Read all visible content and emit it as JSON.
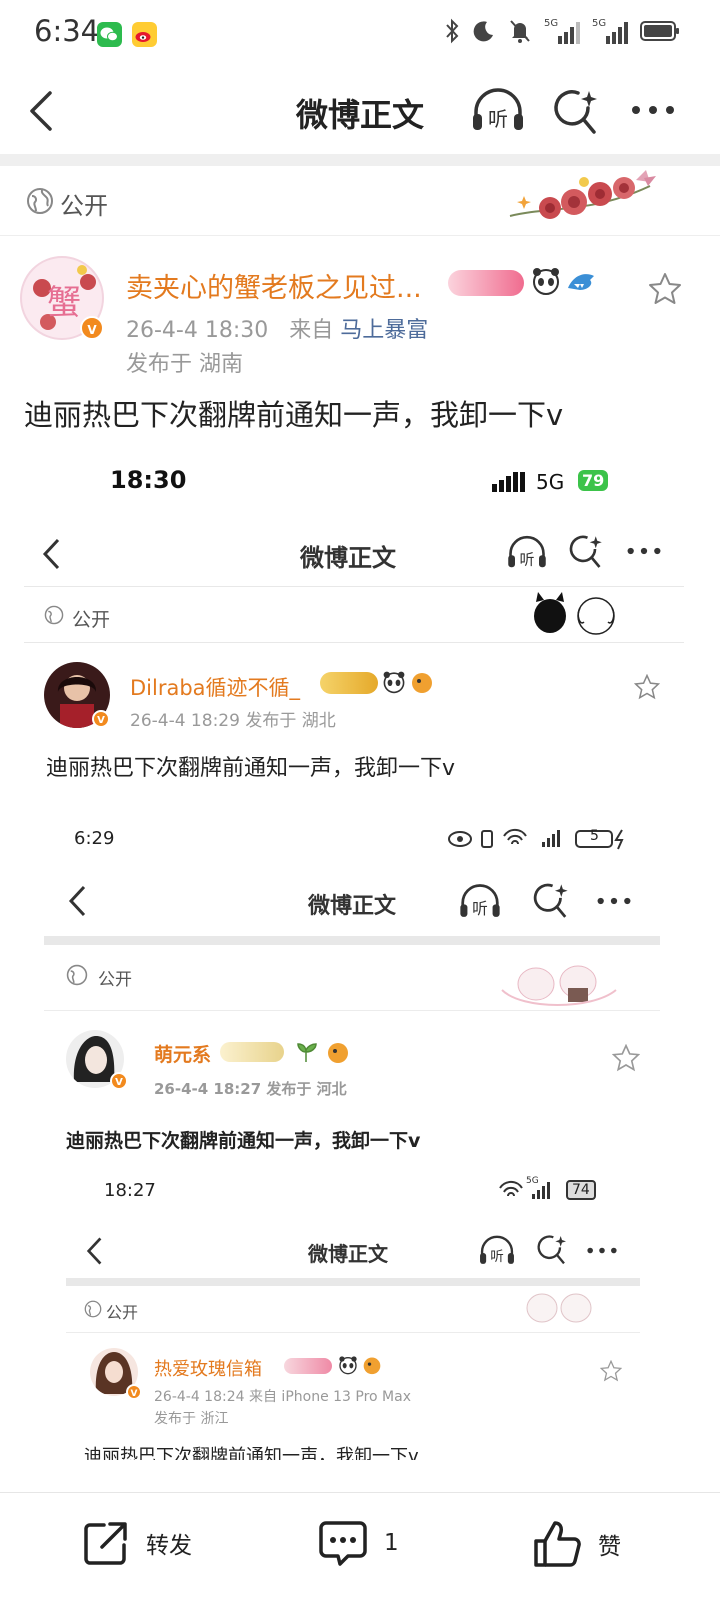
{
  "status_bar": {
    "time": "6:34",
    "network_1": "5G",
    "network_2": "5G"
  },
  "nav": {
    "title": "微博正文"
  },
  "visibility": {
    "label": "公开"
  },
  "post": {
    "author": "卖夹心的蟹老板之见过...",
    "timestamp": "26-4-4 18:30",
    "source_prefix": "来自",
    "source": "马上暴富",
    "location": "发布于 湖南",
    "text": "迪丽热巴下次翻牌前通知一声，我卸一下v"
  },
  "embedded": {
    "shot1": {
      "time": "18:30",
      "network": "5G",
      "battery": "79",
      "title": "微博正文",
      "visibility": "公开",
      "author": "Dilraba循迹不循_",
      "meta": "26-4-4 18:29  发布于 湖北",
      "text": "迪丽热巴下次翻牌前通知一声，我卸一下v"
    },
    "shot2": {
      "time": "6:29",
      "battery": "5",
      "title": "微博正文",
      "visibility": "公开",
      "author": "萌元系",
      "meta": "26-4-4 18:27   发布于 河北",
      "text": "迪丽热巴下次翻牌前通知一声，我卸一下v"
    },
    "shot3": {
      "time": "18:27",
      "network": "5G",
      "battery": "74",
      "title": "微博正文",
      "visibility": "公开",
      "author": "热爱玫瑰信箱",
      "meta_line1": "26-4-4 18:24   来自 iPhone 13 Pro Max",
      "meta_line2": "发布于 浙江",
      "text": "迪丽热巴下次翻牌前通知一声，我卸一下v"
    }
  },
  "toolbar": {
    "repost_label": "转发",
    "comment_count": "1",
    "like_label": "赞"
  },
  "colors": {
    "accent_orange": "#e37a1f",
    "source_blue": "#4d6b9a",
    "vip_badge": "#f28a1e"
  }
}
